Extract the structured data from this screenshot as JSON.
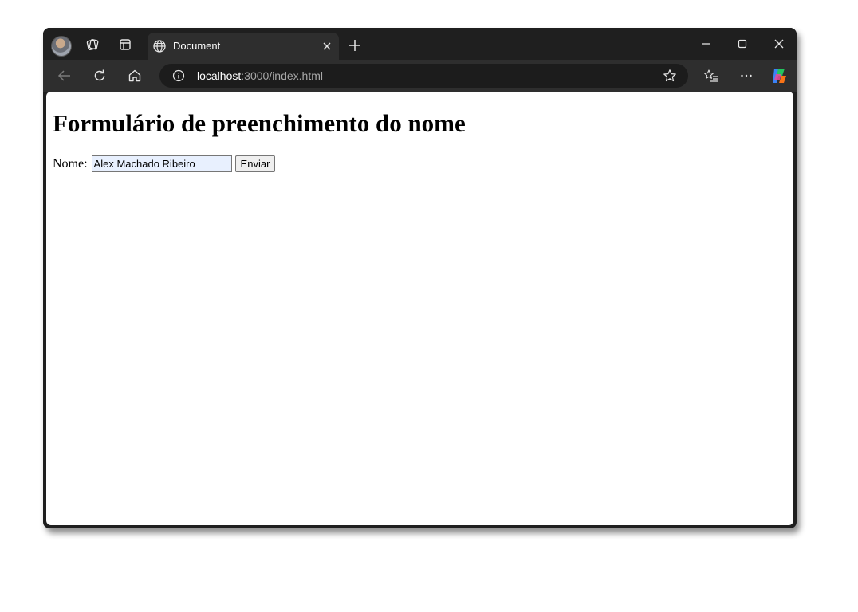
{
  "browser": {
    "tab": {
      "title": "Document"
    },
    "address": {
      "host": "localhost",
      "rest": ":3000/index.html"
    }
  },
  "page": {
    "heading": "Formulário de preenchimento do nome",
    "form": {
      "label": "Nome:",
      "input_value": "Alex Machado Ribeiro",
      "submit_label": "Enviar"
    }
  },
  "icons": {
    "profile": "avatar",
    "workspaces": "workspaces-icon",
    "tab_actions": "tab-actions-icon",
    "favicon": "globe-icon",
    "close_tab": "close-icon",
    "new_tab": "plus-icon",
    "minimize": "minimize-icon",
    "maximize": "maximize-icon",
    "close_window": "close-icon",
    "back": "back-arrow-icon",
    "refresh": "refresh-icon",
    "home": "home-icon",
    "site_info": "info-icon",
    "favorite": "star-icon",
    "favorites": "favorites-list-icon",
    "more": "more-icon",
    "copilot": "copilot-icon"
  }
}
